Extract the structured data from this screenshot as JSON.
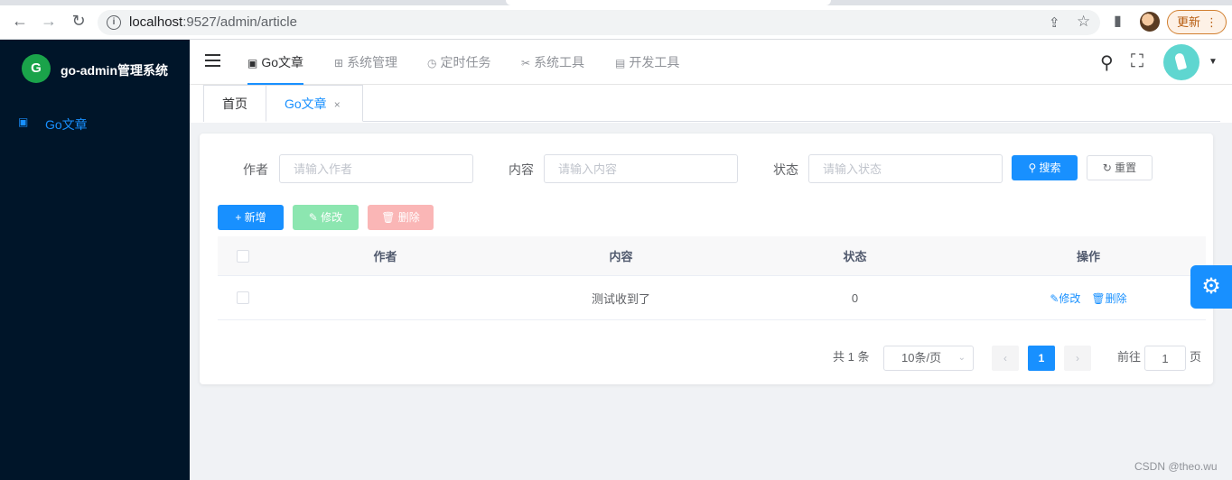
{
  "browser": {
    "url_host": "localhost",
    "url_rest": ":9527/admin/article",
    "update_label": "更新",
    "update_dots": "⋮",
    "back_glyph": "←",
    "forward_glyph": "→",
    "reload_glyph": "↻",
    "info_glyph": "i",
    "share_glyph": "⇪",
    "star_glyph": "☆",
    "sidepanel_glyph": "▮"
  },
  "sidebar": {
    "logo_letter": "G",
    "system_title": "go-admin管理系统",
    "items": [
      {
        "icon": "▣",
        "label": "Go文章"
      }
    ]
  },
  "header": {
    "menus": [
      {
        "icon": "▣",
        "label": "Go文章"
      },
      {
        "icon": "⊞",
        "label": "系统管理"
      },
      {
        "icon": "◷",
        "label": "定时任务"
      },
      {
        "icon": "✂",
        "label": "系统工具"
      },
      {
        "icon": "▤",
        "label": "开发工具"
      }
    ],
    "search_glyph": "⚲",
    "fullscreen_glyph": "⛶",
    "caret_glyph": "▼"
  },
  "tags": [
    {
      "label": "首页"
    },
    {
      "label": "Go文章",
      "close": "×"
    }
  ],
  "search_form": {
    "author_label": "作者",
    "author_placeholder": "请输入作者",
    "content_label": "内容",
    "content_placeholder": "请输入内容",
    "status_label": "状态",
    "status_placeholder": "请输入状态",
    "search_button": "⚲ 搜索",
    "reset_button": "↻ 重置"
  },
  "toolbar": {
    "add": "+ 新增",
    "edit": "✎ 修改",
    "delete": "🗑 删除"
  },
  "table": {
    "columns": [
      "作者",
      "内容",
      "状态",
      "操作"
    ],
    "rows": [
      {
        "author": "",
        "content": "测试收到了",
        "status": "0",
        "edit": "✎修改",
        "delete": "🗑删除"
      }
    ]
  },
  "pagination": {
    "total": "共 1 条",
    "page_size": "10条/页",
    "size_arrow": "⌄",
    "prev": "‹",
    "current": "1",
    "next": "›",
    "goto_prefix": "前往",
    "goto_value": "1",
    "goto_suffix": "页"
  },
  "settings_glyph": "⚙",
  "watermark": "CSDN @theo.wu",
  "colors": {
    "primary": "#1890ff",
    "sidebar_bg": "#001529"
  }
}
